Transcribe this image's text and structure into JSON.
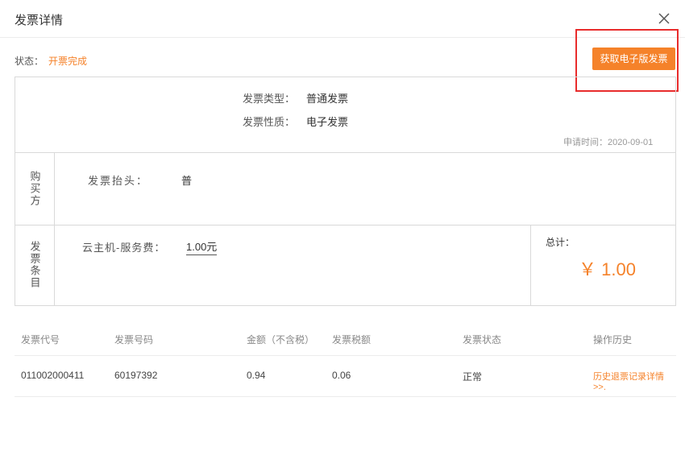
{
  "dialog": {
    "title": "发票详情"
  },
  "status": {
    "label": "状态：",
    "value": "开票完成"
  },
  "actions": {
    "get_e_invoice": "获取电子版发票"
  },
  "invoice": {
    "type_label": "发票类型：",
    "type_value": "普通发票",
    "nature_label": "发票性质：",
    "nature_value": "电子发票",
    "apply_time": "申请时间：2020-09-01"
  },
  "buyer": {
    "side_label": "购买方",
    "header_label": "发票抬头：",
    "header_value": "普"
  },
  "items": {
    "side_label": "发票条目",
    "name": "云主机-服务费：",
    "amount": "1.00元",
    "total_label": "总计：",
    "total_value": "￥ 1.00"
  },
  "table": {
    "columns": [
      "发票代号",
      "发票号码",
      "金额（不含税）",
      "发票税额",
      "发票状态",
      "操作历史"
    ],
    "rows": [
      [
        "011002000411",
        "60197392",
        "0.94",
        "0.06",
        "正常",
        "历史退票记录详情>>."
      ]
    ]
  },
  "colors": {
    "accent": "#f5822a",
    "highlight": "#e82c2c"
  },
  "icons": {
    "close": "close-icon"
  }
}
